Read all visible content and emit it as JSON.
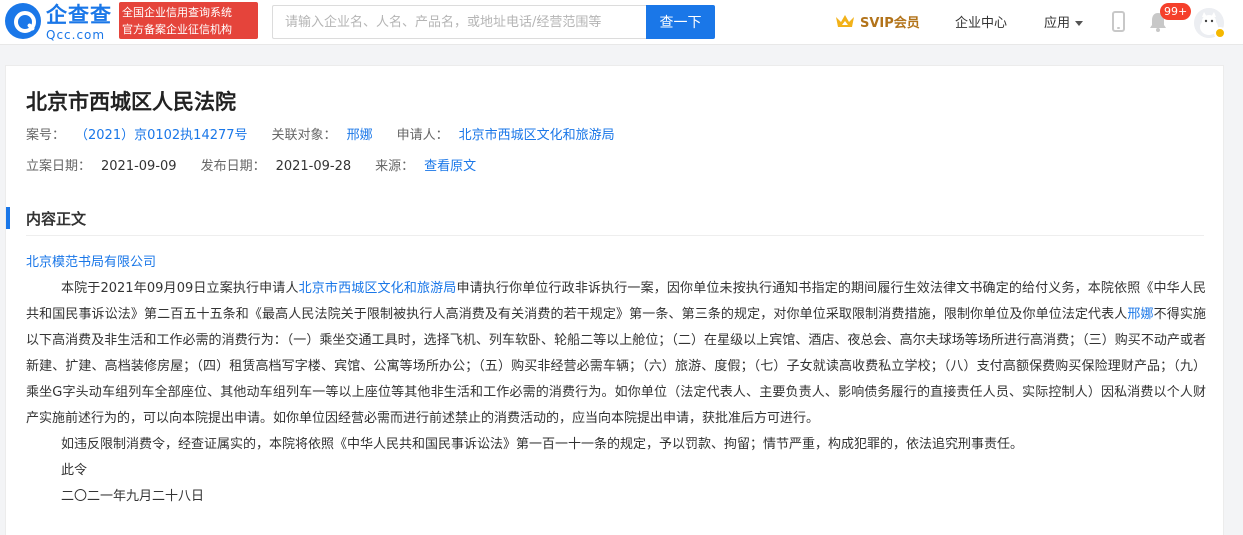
{
  "header": {
    "logo_cn": "企查查",
    "logo_en": "Qcc.com",
    "slogan_line1": "全国企业信用查询系统",
    "slogan_line2": "官方备案企业征信机构",
    "search_placeholder": "请输入企业名、人名、产品名，或地址电话/经营范围等",
    "search_button": "查一下",
    "svip_label": "SVIP会员",
    "enterprise_center": "企业中心",
    "apps_label": "应用",
    "notification_badge": "99+"
  },
  "case": {
    "court": "北京市西城区人民法院",
    "case_no_label": "案号：",
    "case_no": "（2021）京0102执14277号",
    "related_label": "关联对象：",
    "related": "邢娜",
    "applicant_label": "申请人：",
    "applicant": "北京市西城区文化和旅游局",
    "filed_label": "立案日期：",
    "filed": "2021-09-09",
    "published_label": "发布日期：",
    "published": "2021-09-28",
    "source_label": "来源：",
    "source_link": "查看原文"
  },
  "content": {
    "section_title": "内容正文",
    "addressee": "北京模范书局有限公司",
    "p1_a": "本院于2021年09月09日立案执行申请人",
    "p1_applicant": "北京市西城区文化和旅游局",
    "p1_b": "申请执行你单位行政非诉执行一案，因你单位未按执行通知书指定的期间履行生效法律文书确定的给付义务，本院依照《中华人民共和国民事诉讼法》第二百五十五条和《最高人民法院关于限制被执行人高消费及有关消费的若干规定》第一条、第三条的规定，对你单位采取限制消费措施，限制你单位及你单位法定代表人",
    "p1_person": "邢娜",
    "p1_c": "不得实施以下高消费及非生活和工作必需的消费行为：（一）乘坐交通工具时，选择飞机、列车软卧、轮船二等以上舱位；（二）在星级以上宾馆、酒店、夜总会、高尔夫球场等场所进行高消费；（三）购买不动产或者新建、扩建、高档装修房屋；（四）租赁高档写字楼、宾馆、公寓等场所办公；（五）购买非经营必需车辆；（六）旅游、度假；（七）子女就读高收费私立学校；（八）支付高额保费购买保险理财产品；（九）乘坐G字头动车组列车全部座位、其他动车组列车一等以上座位等其他非生活和工作必需的消费行为。如你单位（法定代表人、主要负责人、影响债务履行的直接责任人员、实际控制人）因私消费以个人财产实施前述行为的，可以向本院提出申请。如你单位因经营必需而进行前述禁止的消费活动的，应当向本院提出申请，获批准后方可进行。",
    "p2": "如违反限制消费令，经查证属实的，本院将依照《中华人民共和国民事诉讼法》第一百一十一条的规定，予以罚款、拘留；情节严重，构成犯罪的，依法追究刑事责任。",
    "p3": "此令",
    "p4": "二〇二一年九月二十八日"
  },
  "colors": {
    "brand_blue": "#1a77e8",
    "slogan_red": "#e5443b",
    "svip_gold": "#b2731a",
    "badge_red": "#f5402b"
  },
  "icons": [
    "logo-icon",
    "crown-icon",
    "phone-icon",
    "bell-icon",
    "avatar"
  ]
}
